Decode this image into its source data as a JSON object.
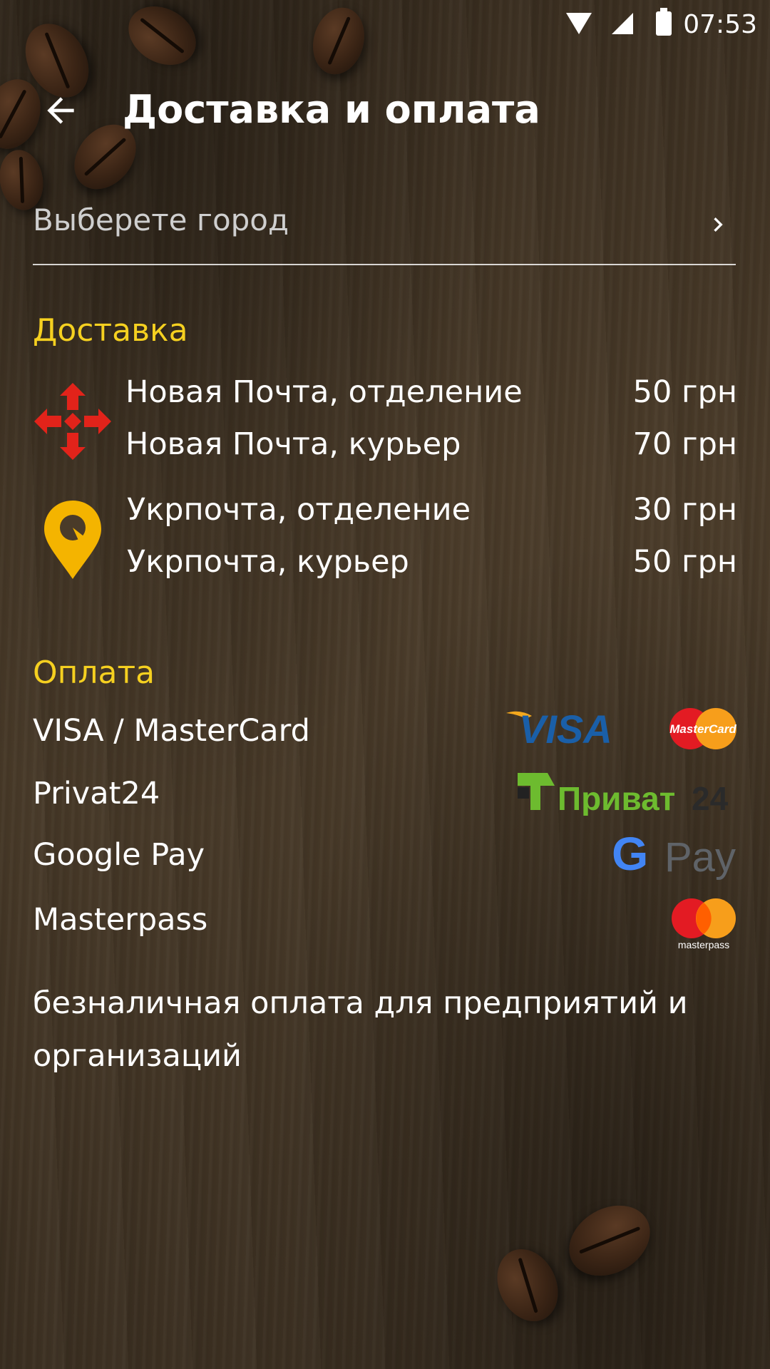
{
  "status": {
    "time": "07:53"
  },
  "header": {
    "title": "Доставка и оплата",
    "back_icon": "arrow-back-icon"
  },
  "city": {
    "placeholder": "Выберете город",
    "icon": "chevron-right-icon"
  },
  "delivery": {
    "title": "Доставка",
    "providers": [
      {
        "logo": "nova-poshta-logo",
        "options": [
          {
            "label": "Новая Почта, отделение",
            "price": "50 грн"
          },
          {
            "label": "Новая Почта, курьер",
            "price": "70 грн"
          }
        ]
      },
      {
        "logo": "ukrposhta-logo",
        "options": [
          {
            "label": "Укрпочта, отделение",
            "price": "30 грн"
          },
          {
            "label": "Укрпочта, курьер",
            "price": "50 грн"
          }
        ]
      }
    ]
  },
  "payment": {
    "title": "Оплата",
    "methods": [
      {
        "label": "VISA / MasterCard",
        "logos": {
          "visa": "VISA",
          "mastercard": "MasterCard"
        }
      },
      {
        "label": "Privat24",
        "logos": {
          "privat_word": "Приват",
          "privat_num": "24"
        }
      },
      {
        "label": "Google Pay",
        "logos": {
          "g": "G",
          "pay": "Pay"
        }
      },
      {
        "label": "Masterpass",
        "logos": {
          "masterpass": "masterpass"
        }
      }
    ],
    "note": "безналичная оплата для предприятий и организаций"
  },
  "colors": {
    "accent": "#f5d020",
    "nova_red": "#e2231a",
    "ukrposhta_yellow": "#f4b400"
  }
}
